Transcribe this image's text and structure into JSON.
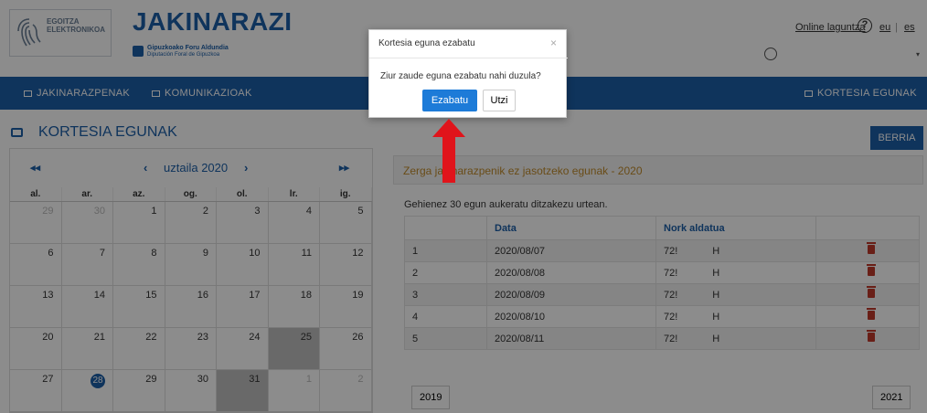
{
  "header": {
    "logo_text_1": "EGOITZA",
    "logo_text_2": "ELEKTRONIKOA",
    "title": "JAKINARAZI",
    "gfa_1": "Gipuzkoako Foru Aldundia",
    "gfa_2": "Diputación Foral de Gipuzkoa",
    "help": "Online laguntza",
    "help_q": "?",
    "lang_eu": "eu",
    "lang_sep": "|",
    "lang_es": "es",
    "user_caret": "▾"
  },
  "nav": {
    "item1": "JAKINARAZPENAK",
    "item2": "KOMUNIKAZIOAK",
    "item3": "KORTESIA EGUNAK"
  },
  "page": {
    "title": "KORTESIA EGUNAK",
    "new_button": "BERRIA"
  },
  "calendar": {
    "prev2": "◂◂",
    "prev": "‹",
    "month": "uztaila 2020",
    "next": "›",
    "next2": "▸▸",
    "weekdays": [
      "al.",
      "ar.",
      "az.",
      "og.",
      "ol.",
      "lr.",
      "ig."
    ],
    "weeks": [
      [
        "29",
        "30",
        "1",
        "2",
        "3",
        "4",
        "5"
      ],
      [
        "6",
        "7",
        "8",
        "9",
        "10",
        "11",
        "12"
      ],
      [
        "13",
        "14",
        "15",
        "16",
        "17",
        "18",
        "19"
      ],
      [
        "20",
        "21",
        "22",
        "23",
        "24",
        "25",
        "26"
      ],
      [
        "27",
        "28",
        "29",
        "30",
        "31",
        "1",
        "2"
      ]
    ]
  },
  "panel": {
    "title": "Zerga jakinarazpenik ez jasotzeko egunak - 2020",
    "note": "Gehienez 30 egun aukeratu ditzakezu urtean.",
    "col_data": "Data",
    "col_nork": "Nork aldatua",
    "rows": [
      {
        "n": "1",
        "date": "2020/08/07",
        "user": "72!",
        "user2": "H"
      },
      {
        "n": "2",
        "date": "2020/08/08",
        "user": "72!",
        "user2": "H"
      },
      {
        "n": "3",
        "date": "2020/08/09",
        "user": "72!",
        "user2": "H"
      },
      {
        "n": "4",
        "date": "2020/08/10",
        "user": "72!",
        "user2": "H"
      },
      {
        "n": "5",
        "date": "2020/08/11",
        "user": "72!",
        "user2": "H"
      }
    ],
    "prev_year": "2019",
    "next_year": "2021"
  },
  "modal": {
    "title": "Kortesia eguna ezabatu",
    "close": "×",
    "message": "Ziur zaude eguna ezabatu nahi duzula?",
    "ok": "Ezabatu",
    "cancel": "Utzi"
  },
  "colors": {
    "primary": "#1d5fa8",
    "arrow": "#e0141b",
    "panel_title": "#c08a2a"
  }
}
